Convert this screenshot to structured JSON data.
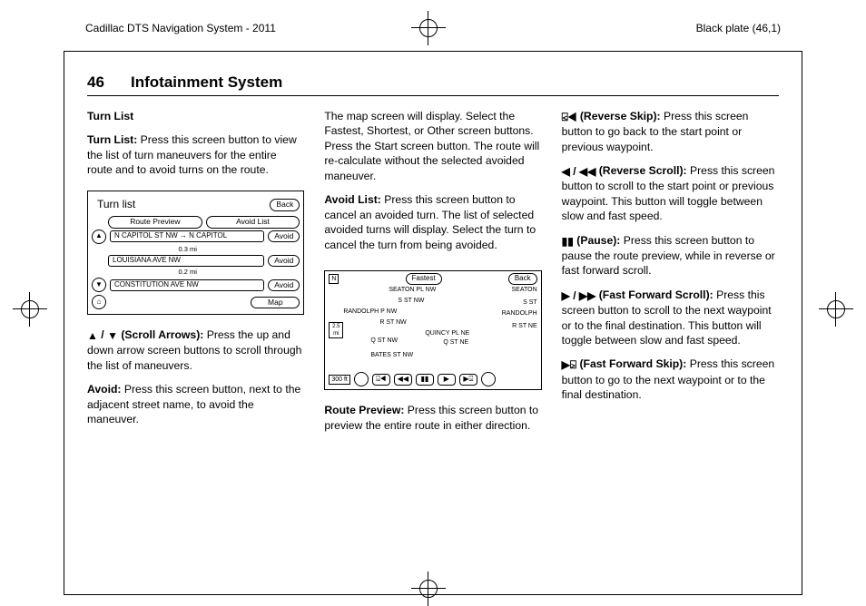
{
  "header": {
    "left": "Cadillac DTS Navigation System - 2011",
    "right": "Black plate (46,1)"
  },
  "running": {
    "num": "46",
    "title": "Infotainment System"
  },
  "col1": {
    "h": "Turn List",
    "p1b": "Turn List:",
    "p1": "  Press this screen button to view the list of turn maneuvers for the entire route and to avoid turns on the route.",
    "fig": {
      "title": "Turn list",
      "back": "Back",
      "routePreview": "Route Preview",
      "avoidList": "Avoid List",
      "r1": "N CAPITOL ST NW → N CAPITOL",
      "d1": "0.3 mi",
      "r2": "LOUISIANA AVE NW",
      "d2": "0.2 mi",
      "r3": "CONSTITUTION AVE NW",
      "avoid": "Avoid",
      "map": "Map"
    },
    "p2a": "▲",
    "p2b": " / ",
    "p2c": "▼",
    "p2d": " (Scroll Arrows):",
    "p2": "  Press the up and down arrow screen buttons to scroll through the list of maneuvers.",
    "p3b": "Avoid:",
    "p3": "  Press this screen button, next to the adjacent street name, to avoid the maneuver."
  },
  "col2": {
    "p1": "The map screen will display. Select the Fastest, Shortest, or Other screen buttons. Press the Start screen button. The route will re-calculate without the selected avoided maneuver.",
    "p2b": "Avoid List:",
    "p2": "  Press this screen button to cancel an avoided turn. The list of selected avoided turns will display. Select the turn to cancel the turn from being avoided.",
    "fig": {
      "n": "N",
      "fastest": "Fastest",
      "back": "Back",
      "s1": "SEATON  PL  NW",
      "s2": "S  ST  NW",
      "s3": "RANDOLPH  P NW",
      "s4": "R  ST  NW",
      "s5": "QUINCY  PL  NE",
      "s6": "Q  ST  NW",
      "s7": "Q  ST  NE",
      "s8": "BATES  ST  NW",
      "sideA": "SEATON",
      "sideB": "S  ST",
      "sideC": "RANDOLPH",
      "sideD": "R  ST  NE",
      "scale1": "2.5",
      "scale2": "mi",
      "dist": "300 ft",
      "b1": "⍃◀",
      "b2": "◀◀",
      "b3": "▮▮",
      "b4": "▶",
      "b5": "▶⍄"
    },
    "p3b": "Route Preview:",
    "p3": "  Press this screen button to preview the entire route in either direction."
  },
  "col3": {
    "a1i": "⍃◀",
    "a1b": " (Reverse Skip):",
    "a1": "  Press this screen button to go back to the start point or previous waypoint.",
    "a2i": "◀ / ◀◀",
    "a2b": " (Reverse Scroll):",
    "a2": "  Press this screen button to scroll to the start point or previous waypoint. This button will toggle between slow and fast speed.",
    "a3i": "▮▮",
    "a3b": " (Pause):",
    "a3": "  Press this screen button to pause the route preview, while in reverse or fast forward scroll.",
    "a4i": "▶ / ▶▶",
    "a4b": " (Fast Forward Scroll):",
    "a4": "  Press this screen button to scroll to the next waypoint or to the final destination. This button will toggle between slow and fast speed.",
    "a5i": "▶⍄",
    "a5b": " (Fast Forward Skip):",
    "a5": "  Press this screen button to go to the next waypoint or to the final destination."
  }
}
